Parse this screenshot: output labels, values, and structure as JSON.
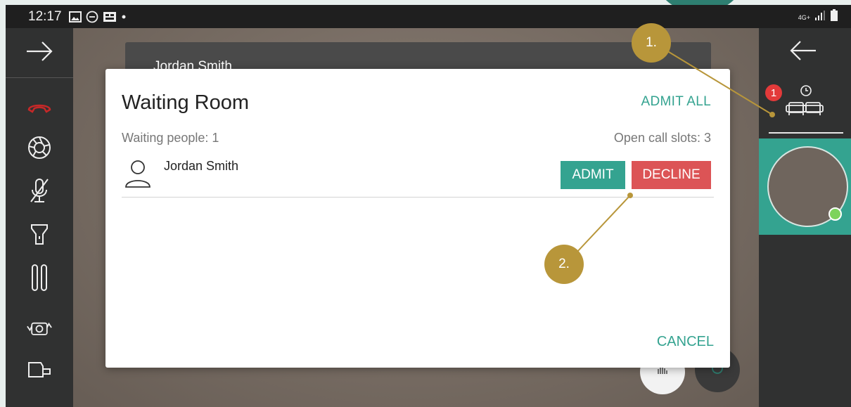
{
  "status_bar": {
    "time": "12:17",
    "icons": [
      "image-icon",
      "do-not-disturb-icon",
      "notification-icon",
      "dot-icon"
    ],
    "right_icons": [
      "4g-icon",
      "signal-icon",
      "battery-icon"
    ],
    "network_label": "4G+"
  },
  "background": {
    "participant_name": "Jordan Smith"
  },
  "left_toolbar": {
    "items": [
      "arrow-right-icon",
      "hangup-icon",
      "shutter-icon",
      "mic-off-icon",
      "flashlight-icon",
      "pause-icon",
      "switch-camera-icon",
      "video-camera-icon"
    ]
  },
  "right_panel": {
    "back_icon": "arrow-left-icon",
    "waiting_badge": "1",
    "waiting_icon": "waiting-room-icon"
  },
  "dialog": {
    "title": "Waiting Room",
    "admit_all_label": "ADMIT ALL",
    "waiting_people": "Waiting people: 1",
    "open_slots": "Open call slots: 3",
    "people": [
      {
        "name": "Jordan Smith",
        "admit_label": "ADMIT",
        "decline_label": "DECLINE"
      }
    ],
    "cancel_label": "CANCEL"
  },
  "callouts": [
    "1.",
    "2."
  ],
  "colors": {
    "accent": "#34a390",
    "decline": "#dc5456",
    "callout": "#b8963a",
    "badge": "#e33a3a"
  }
}
